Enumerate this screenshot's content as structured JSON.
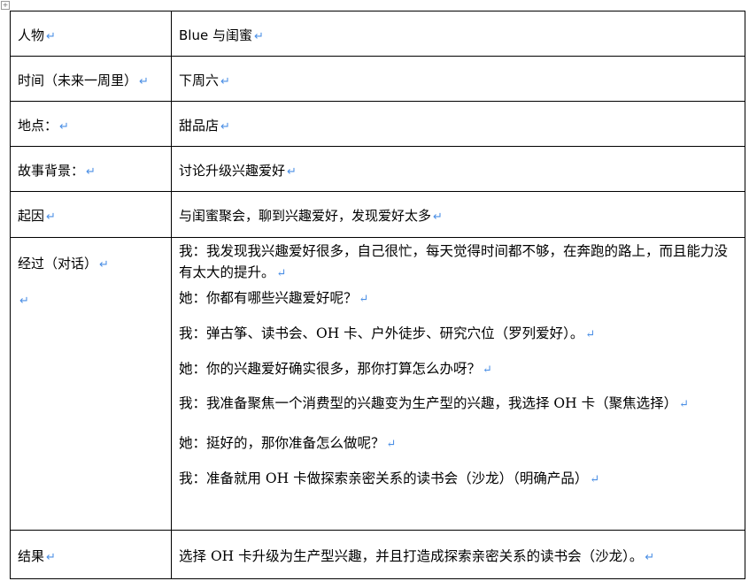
{
  "rows": [
    {
      "label": "人物",
      "value": "Blue 与闺蜜"
    },
    {
      "label": "时间（未来一周里）",
      "value": "下周六"
    },
    {
      "label": "地点：",
      "value": "甜品店"
    },
    {
      "label": "故事背景：",
      "value": "讨论升级兴趣爱好"
    },
    {
      "label": "起因",
      "value": "与闺蜜聚会，聊到兴趣爱好，发现爱好太多"
    }
  ],
  "process": {
    "label": "经过（对话）",
    "lines": [
      {
        "text": "我：我发现我兴趣爱好很多，自己很忙，每天觉得时间都不够，在奔跑的路上，而且能力没有太大的提升。",
        "note": ""
      },
      {
        "text": "她：你都有哪些兴趣爱好呢？",
        "note": ""
      },
      {
        "text": "我：弹古筝、读书会、OH 卡、户外徒步、研究穴位",
        "note": "（罗列爱好）。"
      },
      {
        "text": "她：你的兴趣爱好确实很多，那你打算怎么办呀？",
        "note": ""
      },
      {
        "text": "我：我准备聚焦一个消费型的兴趣变为生产型的兴趣，我选择 OH 卡（",
        "note": "聚焦选择）"
      },
      {
        "text": "她：挺好的，那你准备怎么做呢？",
        "note": ""
      },
      {
        "text": "我：准备就用 OH 卡做探索亲密关系的读书会（沙龙）",
        "note": "（明确产品）"
      }
    ]
  },
  "result": {
    "label": "结果",
    "prefix": "选择",
    "text": " OH 卡升级为生产型兴趣，并且打造成探索亲密关系的读书会（沙龙）。"
  },
  "marks": {
    "paragraph": "↵",
    "move": "+"
  }
}
